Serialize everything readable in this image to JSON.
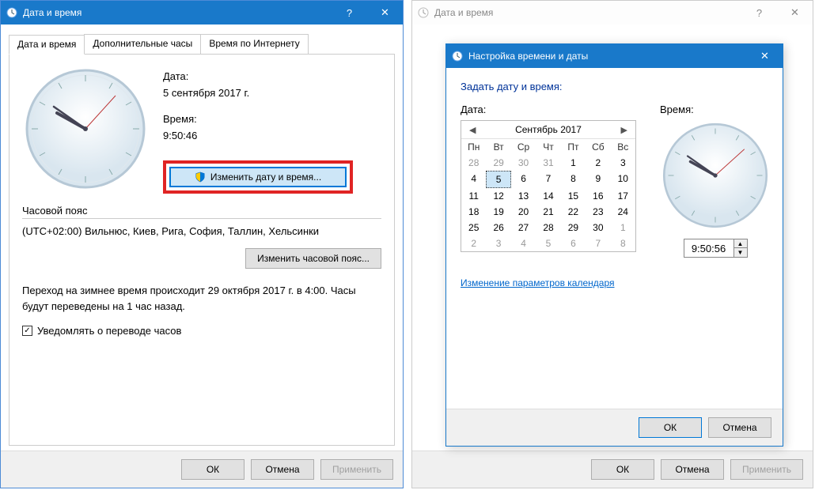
{
  "window1": {
    "title": "Дата и время",
    "tabs": [
      "Дата и время",
      "Дополнительные часы",
      "Время по Интернету"
    ],
    "date_label": "Дата:",
    "date_value": "5 сентября 2017 г.",
    "time_label": "Время:",
    "time_value": "9:50:46",
    "change_dt_btn": "Изменить дату и время...",
    "tz_section": "Часовой пояс",
    "tz_value": "(UTC+02:00) Вильнюс, Киев, Рига, София, Таллин, Хельсинки",
    "change_tz_btn": "Изменить часовой пояс...",
    "dst_msg": "Переход на зимнее время происходит 29 октября 2017 г. в 4:00. Часы будут переведены на 1 час назад.",
    "notify_chk": "Уведомлять о переводе часов",
    "ok": "ОК",
    "cancel": "Отмена",
    "apply": "Применить"
  },
  "window2": {
    "title": "Дата и время",
    "ok": "ОК",
    "cancel": "Отмена",
    "apply": "Применить"
  },
  "dialog": {
    "title": "Настройка времени и даты",
    "heading": "Задать дату и время:",
    "date_label": "Дата:",
    "time_label": "Время:",
    "month": "Сентябрь 2017",
    "dow": [
      "Пн",
      "Вт",
      "Ср",
      "Чт",
      "Пт",
      "Сб",
      "Вс"
    ],
    "weeks": [
      [
        {
          "d": 28,
          "o": true
        },
        {
          "d": 29,
          "o": true
        },
        {
          "d": 30,
          "o": true
        },
        {
          "d": 31,
          "o": true
        },
        {
          "d": 1
        },
        {
          "d": 2
        },
        {
          "d": 3
        }
      ],
      [
        {
          "d": 4
        },
        {
          "d": 5,
          "sel": true
        },
        {
          "d": 6
        },
        {
          "d": 7
        },
        {
          "d": 8
        },
        {
          "d": 9
        },
        {
          "d": 10
        }
      ],
      [
        {
          "d": 11
        },
        {
          "d": 12
        },
        {
          "d": 13
        },
        {
          "d": 14
        },
        {
          "d": 15
        },
        {
          "d": 16
        },
        {
          "d": 17
        }
      ],
      [
        {
          "d": 18
        },
        {
          "d": 19
        },
        {
          "d": 20
        },
        {
          "d": 21
        },
        {
          "d": 22
        },
        {
          "d": 23
        },
        {
          "d": 24
        }
      ],
      [
        {
          "d": 25
        },
        {
          "d": 26
        },
        {
          "d": 27
        },
        {
          "d": 28
        },
        {
          "d": 29
        },
        {
          "d": 30
        },
        {
          "d": 1,
          "o": true
        }
      ],
      [
        {
          "d": 2,
          "o": true
        },
        {
          "d": 3,
          "o": true
        },
        {
          "d": 4,
          "o": true
        },
        {
          "d": 5,
          "o": true
        },
        {
          "d": 6,
          "o": true
        },
        {
          "d": 7,
          "o": true
        },
        {
          "d": 8,
          "o": true
        }
      ]
    ],
    "time_value": "9:50:56",
    "link": "Изменение параметров календаря",
    "ok": "ОК",
    "cancel": "Отмена"
  }
}
